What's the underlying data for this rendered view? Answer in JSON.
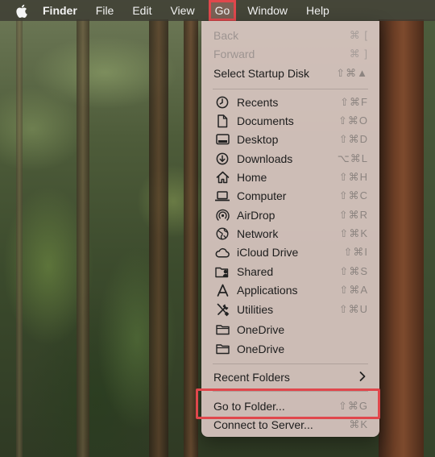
{
  "menubar": {
    "app_name": "Finder",
    "items": [
      "File",
      "Edit",
      "View",
      "Go",
      "Window",
      "Help"
    ]
  },
  "go_menu": {
    "top_items": [
      {
        "label": "Back",
        "shortcut": "⌘ [",
        "disabled": true
      },
      {
        "label": "Forward",
        "shortcut": "⌘ ]",
        "disabled": true
      },
      {
        "label": "Select Startup Disk",
        "shortcut": "⇧⌘▲",
        "disabled": false
      }
    ],
    "places": [
      {
        "label": "Recents",
        "shortcut": "⇧⌘F",
        "icon": "clock-icon"
      },
      {
        "label": "Documents",
        "shortcut": "⇧⌘O",
        "icon": "document-icon"
      },
      {
        "label": "Desktop",
        "shortcut": "⇧⌘D",
        "icon": "desktop-icon"
      },
      {
        "label": "Downloads",
        "shortcut": "⌥⌘L",
        "icon": "download-icon"
      },
      {
        "label": "Home",
        "shortcut": "⇧⌘H",
        "icon": "home-icon"
      },
      {
        "label": "Computer",
        "shortcut": "⇧⌘C",
        "icon": "laptop-icon"
      },
      {
        "label": "AirDrop",
        "shortcut": "⇧⌘R",
        "icon": "airdrop-icon"
      },
      {
        "label": "Network",
        "shortcut": "⇧⌘K",
        "icon": "globe-icon"
      },
      {
        "label": "iCloud Drive",
        "shortcut": "⇧⌘I",
        "icon": "cloud-icon"
      },
      {
        "label": "Shared",
        "shortcut": "⇧⌘S",
        "icon": "shared-folder-icon"
      },
      {
        "label": "Applications",
        "shortcut": "⇧⌘A",
        "icon": "applications-icon"
      },
      {
        "label": "Utilities",
        "shortcut": "⇧⌘U",
        "icon": "utilities-icon"
      },
      {
        "label": "OneDrive",
        "shortcut": "",
        "icon": "folder-icon"
      },
      {
        "label": "OneDrive",
        "shortcut": "",
        "icon": "folder-icon"
      }
    ],
    "recent_folders": {
      "label": "Recent Folders"
    },
    "go_to_folder": {
      "label": "Go to Folder...",
      "shortcut": "⇧⌘G"
    },
    "connect_to_server": {
      "label": "Connect to Server...",
      "shortcut": "⌘K"
    }
  },
  "colors": {
    "highlight_outline": "#e0474c",
    "menu_background": "#d6c4be"
  }
}
